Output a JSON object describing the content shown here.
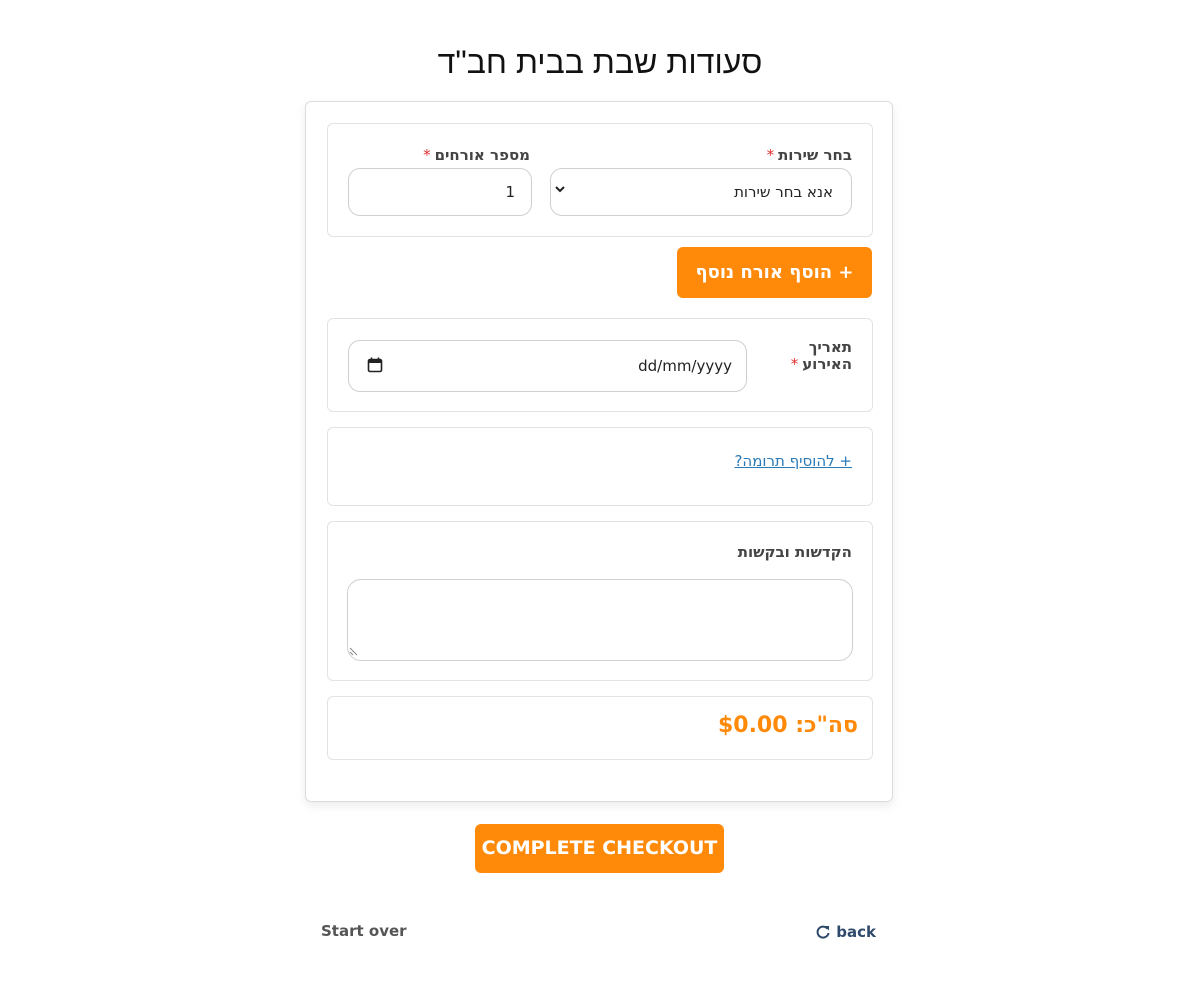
{
  "page": {
    "title": "סעודות שבת בבית חב\"ד"
  },
  "form": {
    "service": {
      "label": "בחר שירות",
      "required_mark": "*",
      "value": "אנא בחר שירות"
    },
    "guests": {
      "label": "מספר אורחים",
      "required_mark": "*",
      "value": "1"
    },
    "add_guest_button": "+ הוסף אורח נוסף",
    "event_date": {
      "label_line1": "תאריך",
      "label_line2": "האירוע",
      "required_mark": "*",
      "placeholder": "dd/mm/yyyy"
    },
    "donation_link": "+ להוסיף תרומה?",
    "dedications": {
      "label": "הקדשות ובקשות",
      "value": ""
    },
    "total": "סה\"כ: $0.00"
  },
  "actions": {
    "checkout_button": "COMPLETE CHECKOUT",
    "start_over": "Start over",
    "back": "back"
  },
  "colors": {
    "accent": "#ff8a0a",
    "link": "#2a7ab8",
    "required": "#e03030"
  },
  "icons": {
    "back": "redo-arrow-icon",
    "calendar": "calendar-icon",
    "dropdown": "chevron-down-icon",
    "resize": "resize-handle-icon"
  }
}
